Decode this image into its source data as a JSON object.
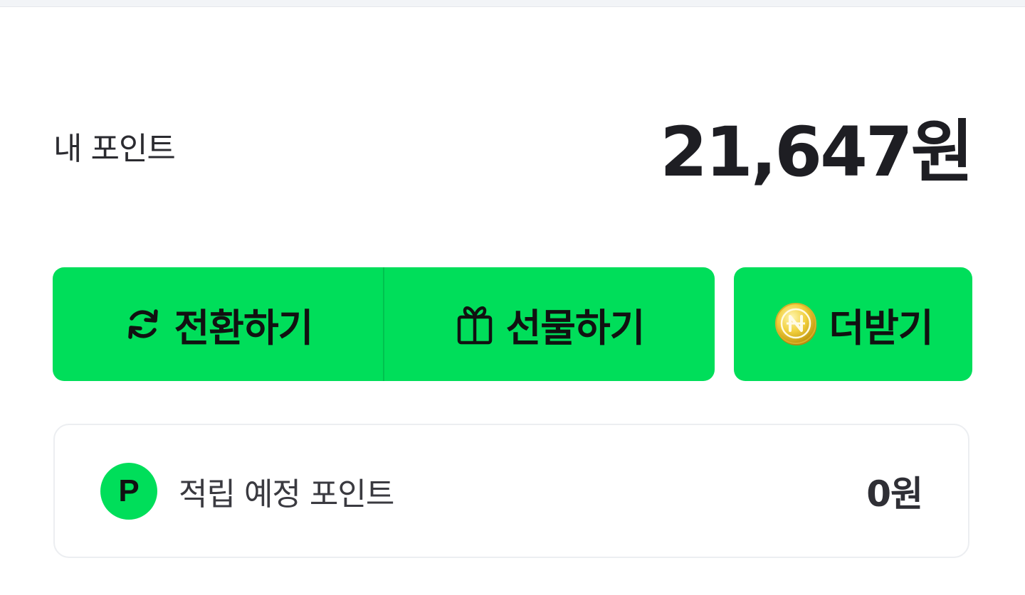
{
  "points": {
    "label": "내 포인트",
    "value": "21,647원"
  },
  "actions": {
    "convert_label": "전환하기",
    "gift_label": "선물하기",
    "more_label": "더받기",
    "convert_icon": "refresh-icon",
    "gift_icon": "gift-icon",
    "more_icon": "coin-icon"
  },
  "pending": {
    "badge": "P",
    "label": "적립 예정 포인트",
    "value": "0원"
  },
  "colors": {
    "accent": "#00de5a",
    "text": "#1e1e23"
  }
}
